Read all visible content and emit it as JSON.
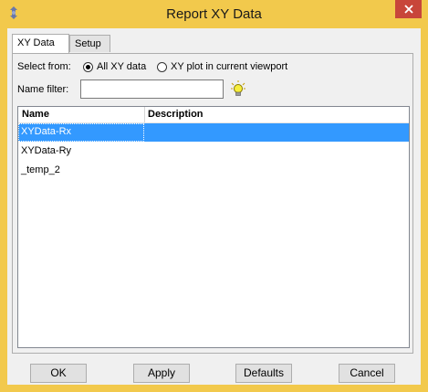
{
  "window": {
    "title": "Report XY Data"
  },
  "tabs": [
    {
      "label": "XY Data",
      "active": true
    },
    {
      "label": "Setup",
      "active": false
    }
  ],
  "select_from": {
    "label": "Select from:",
    "options": [
      {
        "label": "All XY data",
        "selected": true
      },
      {
        "label": "XY plot in current viewport",
        "selected": false
      }
    ]
  },
  "name_filter": {
    "label": "Name filter:",
    "value": ""
  },
  "table": {
    "columns": [
      "Name",
      "Description"
    ],
    "rows": [
      {
        "name": "XYData-Rx",
        "description": "",
        "selected": true
      },
      {
        "name": "XYData-Ry",
        "description": "",
        "selected": false
      },
      {
        "name": "_temp_2",
        "description": "",
        "selected": false
      }
    ]
  },
  "buttons": {
    "ok": "OK",
    "apply": "Apply",
    "defaults": "Defaults",
    "cancel": "Cancel"
  },
  "colors": {
    "titlebar": "#f2c94c",
    "close": "#c8463a",
    "selection": "#3399ff"
  },
  "icons": {
    "app": "abaqus-app-icon",
    "close": "close-icon",
    "filter": "lightbulb-icon"
  }
}
